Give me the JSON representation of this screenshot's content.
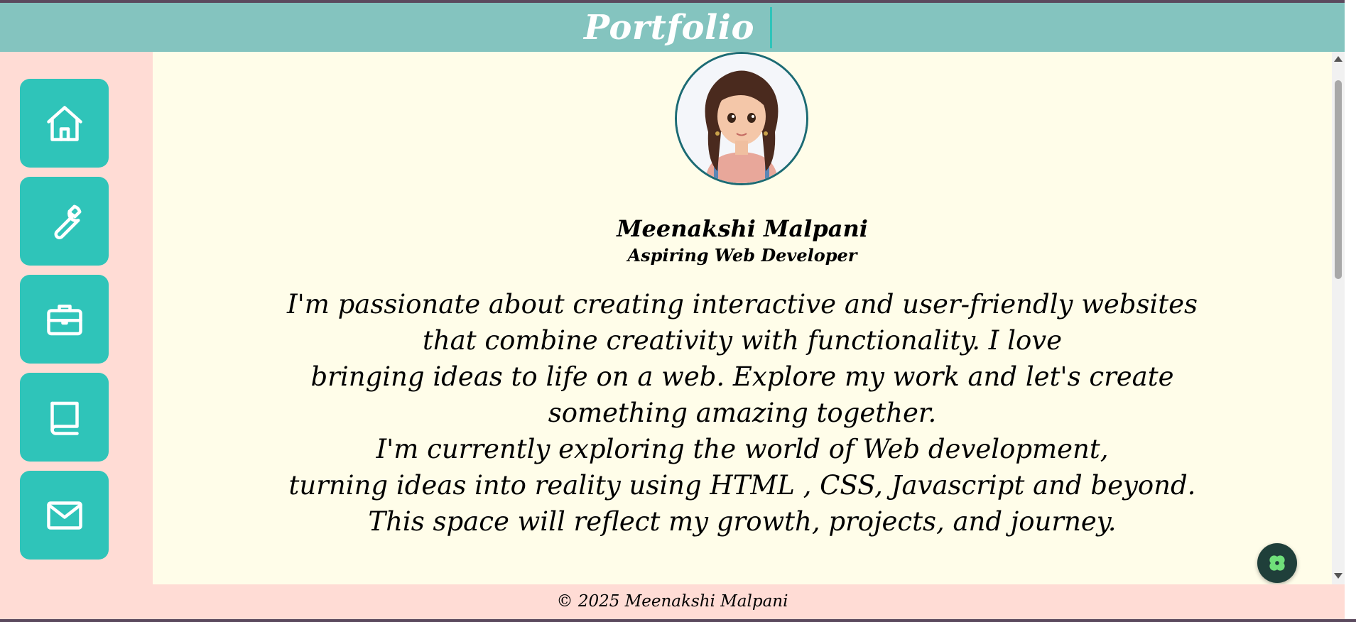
{
  "header": {
    "title": "Portfolio"
  },
  "sidebar": {
    "items": [
      {
        "icon": "home-icon"
      },
      {
        "icon": "wrench-icon"
      },
      {
        "icon": "briefcase-icon"
      },
      {
        "icon": "book-icon"
      },
      {
        "icon": "mail-icon"
      }
    ]
  },
  "profile": {
    "name": "Meenakshi Malpani",
    "role": "Aspiring Web Developer",
    "bio_lines": [
      "I'm passionate about creating interactive and user-friendly websites",
      "that combine creativity with functionality. I love",
      "bringing ideas to life on a web. Explore my work and let's create",
      "something amazing together.",
      "I'm currently exploring the world of Web development,",
      "turning ideas into reality using HTML , CSS, Javascript and beyond.",
      "This space will reflect my growth, projects, and journey."
    ]
  },
  "footer": {
    "text": "© 2025 Meenakshi Malpani"
  },
  "colors": {
    "header_bg": "#84c4bf",
    "accent": "#2fc4b9",
    "sidebar_bg": "#ffdcd5",
    "main_bg": "#fffde9"
  }
}
